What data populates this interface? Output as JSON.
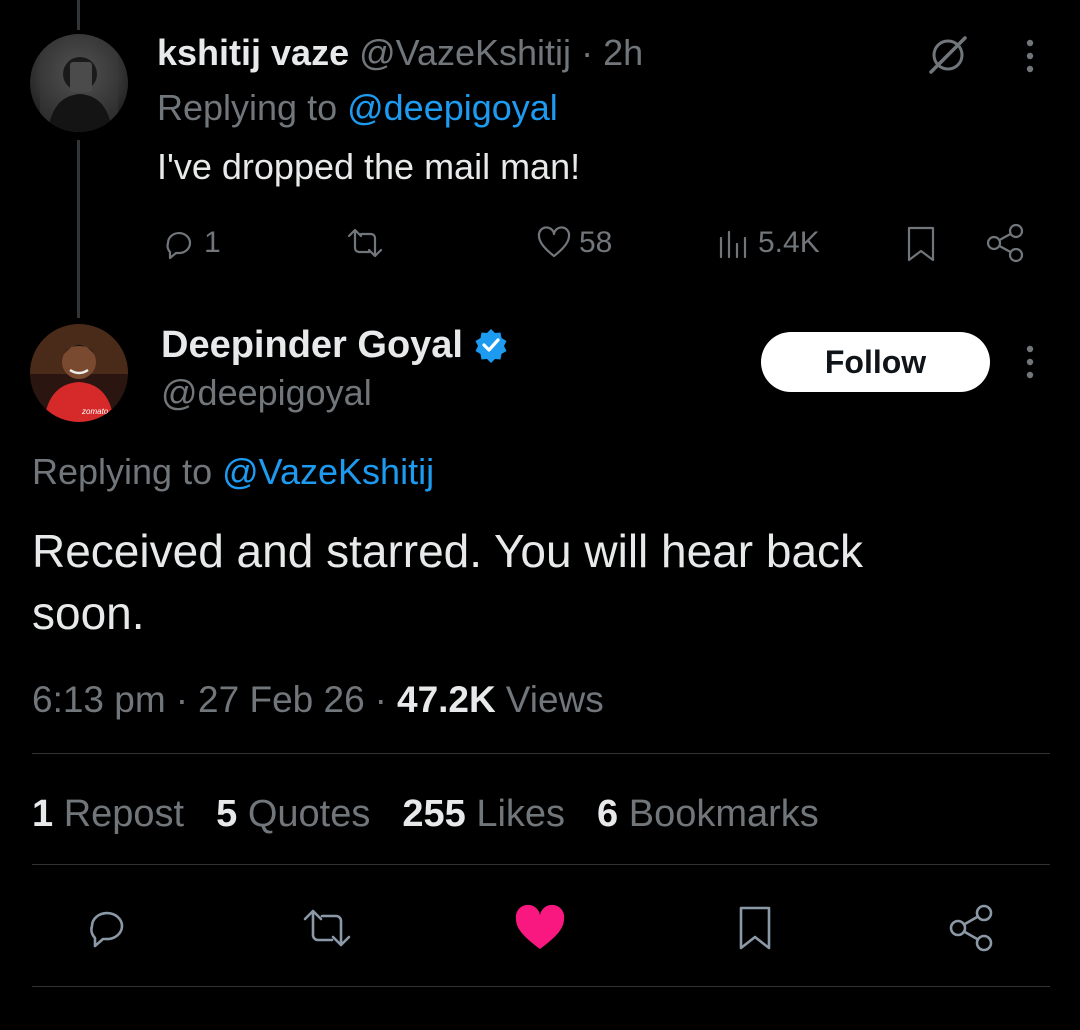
{
  "reply_tweet": {
    "author_name": "kshitij vaze",
    "handle": "@VazeKshitij",
    "separator": "·",
    "time": "2h",
    "replying_prefix": "Replying to",
    "replying_to": "@deepigoyal",
    "text": "I've dropped the mail man!",
    "actions": {
      "replies": "1",
      "reposts": "",
      "likes": "58",
      "views": "5.4K"
    }
  },
  "main_tweet": {
    "author_name": "Deepinder Goyal",
    "handle": "@deepigoyal",
    "follow_label": "Follow",
    "replying_prefix": "Replying to",
    "replying_to": "@VazeKshitij",
    "text_line1": "Received and starred. You will hear back",
    "text_line2": "soon.",
    "time": "6:13 pm",
    "sep1": "·",
    "date": "27 Feb 26",
    "sep2": "·",
    "views_count": "47.2K",
    "views_label": "Views"
  },
  "stats": [
    {
      "count": "1",
      "label": "Repost"
    },
    {
      "count": "5",
      "label": "Quotes"
    },
    {
      "count": "255",
      "label": "Likes"
    },
    {
      "count": "6",
      "label": "Bookmarks"
    }
  ],
  "colors": {
    "background": "#000000",
    "link": "#1d9bf0",
    "muted": "#71767b",
    "like_active": "#f91880",
    "verified": "#1d9bf0"
  },
  "icons": {
    "reply": "comment-icon",
    "repost": "repost-icon",
    "like": "heart-icon",
    "views": "bar-chart-icon",
    "bookmark": "bookmark-icon",
    "share": "share-icon",
    "grok": "grok-icon",
    "more": "more-vertical-icon",
    "verified": "verified-badge-icon"
  }
}
